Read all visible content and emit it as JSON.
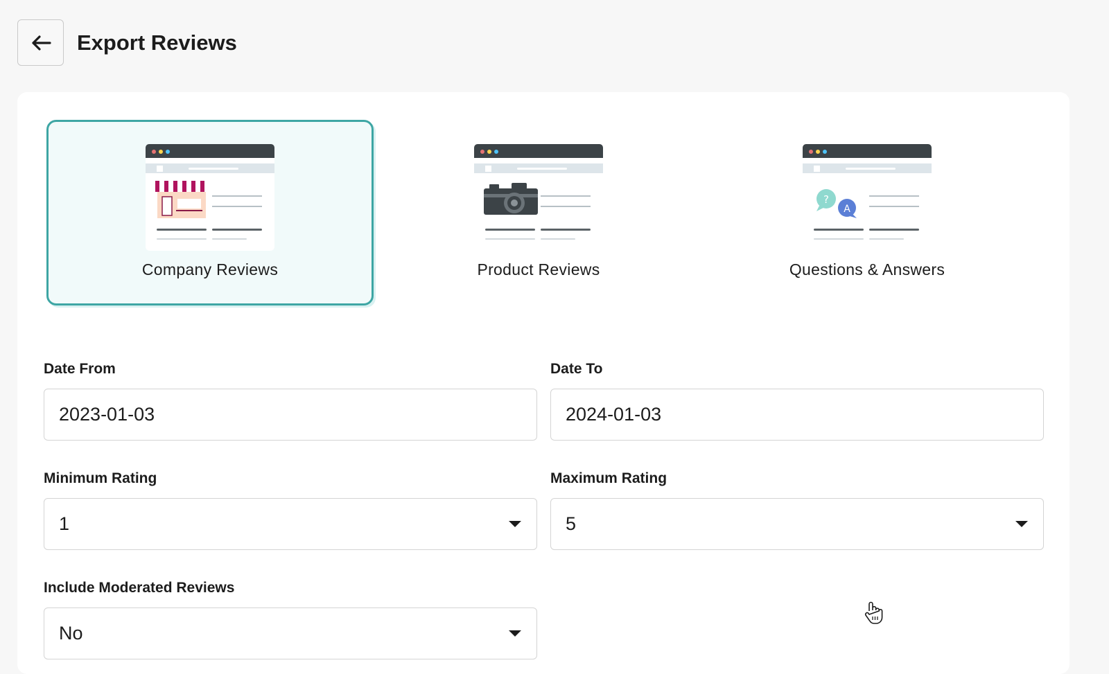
{
  "header": {
    "back_icon": "arrow-left-icon",
    "title": "Export Reviews"
  },
  "review_types": [
    {
      "label": "Company Reviews",
      "icon": "storefront-illustration",
      "selected": true
    },
    {
      "label": "Product Reviews",
      "icon": "camera-illustration",
      "selected": false
    },
    {
      "label": "Questions & Answers",
      "icon": "qa-chat-illustration",
      "selected": false
    }
  ],
  "form": {
    "date_from": {
      "label": "Date From",
      "value": "2023-01-03"
    },
    "date_to": {
      "label": "Date To",
      "value": "2024-01-03"
    },
    "min_rating": {
      "label": "Minimum Rating",
      "value": "1"
    },
    "max_rating": {
      "label": "Maximum Rating",
      "value": "5"
    },
    "include_moderated": {
      "label": "Include Moderated Reviews",
      "value": "No"
    }
  },
  "colors": {
    "accent": "#3ea6a4",
    "selected_bg": "#f1fafa",
    "page_bg": "#f7f7f7"
  }
}
